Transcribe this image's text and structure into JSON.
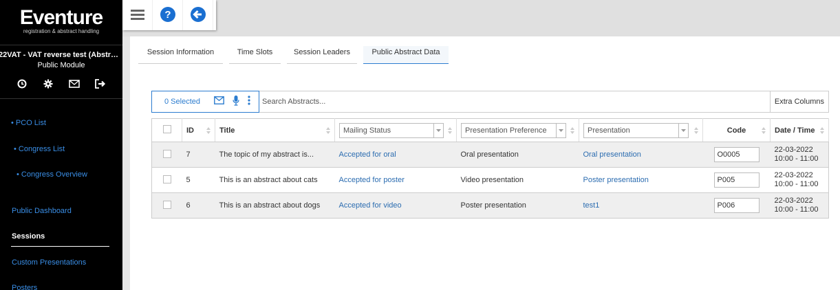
{
  "logo": {
    "name": "Eventure",
    "tagline": "registration & abstract handling"
  },
  "event": {
    "title": "22VAT - VAT reverse test (Abstract...",
    "subtitle": "Public Module"
  },
  "sidebar": {
    "icons": [
      "clock-icon",
      "gear-icon",
      "mail-icon",
      "logout-icon"
    ],
    "items": [
      {
        "label": "• PCO List"
      },
      {
        "label": "• Congress List"
      },
      {
        "label": "• Congress Overview"
      },
      {
        "label": "Public Dashboard"
      },
      {
        "label": "Sessions"
      },
      {
        "label": "Custom Presentations"
      },
      {
        "label": "Posters"
      }
    ]
  },
  "toolbar_top": {
    "icons": [
      "menu-icon",
      "help-icon",
      "back-icon"
    ]
  },
  "tabs": [
    {
      "label": "Session Information"
    },
    {
      "label": "Time Slots"
    },
    {
      "label": "Session Leaders"
    },
    {
      "label": "Public Abstract Data"
    }
  ],
  "toolbar": {
    "selected": "0 Selected",
    "search_placeholder": "Search Abstracts...",
    "extra_columns": "Extra Columns"
  },
  "table": {
    "headers": {
      "id": "ID",
      "title": "Title",
      "mailing_status": "Mailing Status",
      "presentation_preference": "Presentation Preference",
      "presentation": "Presentation",
      "code": "Code",
      "date_time": "Date / Time"
    },
    "rows": [
      {
        "id": "7",
        "title": "The topic of my abstract is...",
        "mailing_status": "Accepted for oral",
        "preference": "Oral presentation",
        "presentation": "Oral presentation",
        "code": "O0005",
        "date": "22-03-2022",
        "time": "10:00 - 11:00"
      },
      {
        "id": "5",
        "title": "This is an abstract about cats",
        "mailing_status": "Accepted for poster",
        "preference": "Video presentation",
        "presentation": "Poster presentation",
        "code": "P005",
        "date": "22-03-2022",
        "time": "10:00 - 11:00"
      },
      {
        "id": "6",
        "title": "This is an abstract about dogs",
        "mailing_status": "Accepted for video",
        "preference": "Poster presentation",
        "presentation": "test1",
        "code": "P006",
        "date": "22-03-2022",
        "time": "10:00 - 11:00"
      }
    ]
  },
  "colors": {
    "accent": "#2b7ccf",
    "link": "#2b6cb0",
    "sidebar_bg": "#000000",
    "nav_link": "#3a8ee6"
  }
}
